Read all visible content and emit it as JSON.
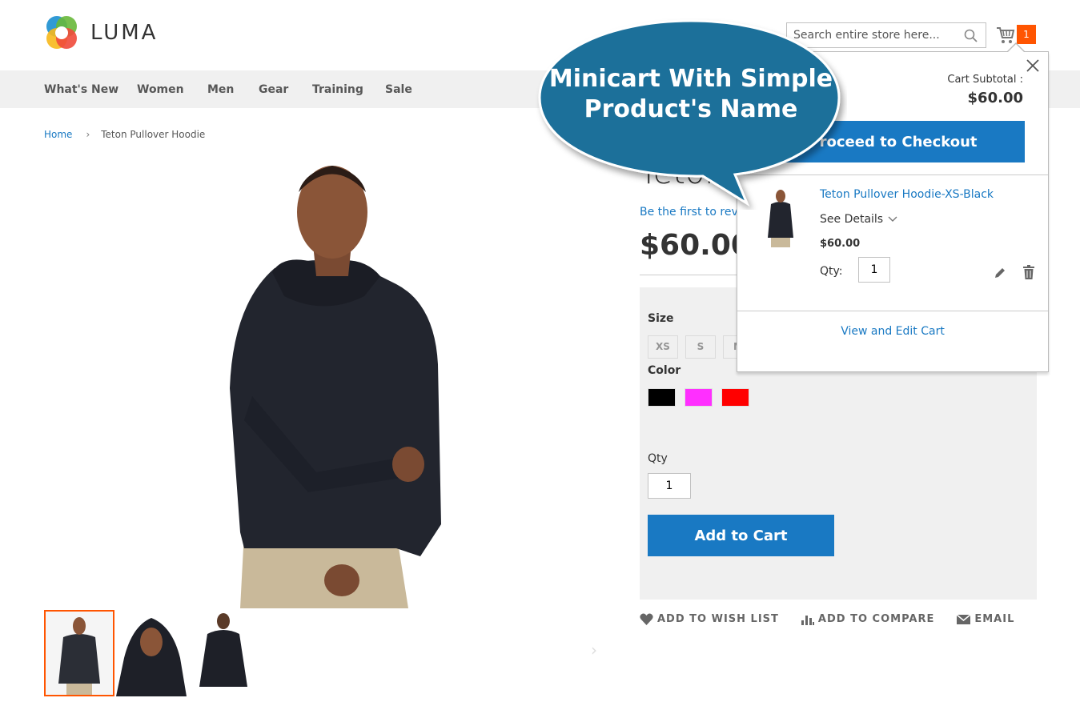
{
  "header": {
    "logo_text": "LUMA",
    "search_placeholder": "Search entire store here...",
    "cart_count": "1"
  },
  "nav": {
    "items": [
      "What's New",
      "Women",
      "Men",
      "Gear",
      "Training",
      "Sale"
    ]
  },
  "breadcrumb": {
    "home": "Home",
    "current": "Teton Pullover Hoodie"
  },
  "product": {
    "title": "Teton P",
    "review_link": "Be the first to revie",
    "price": "$60.00",
    "size_label": "Size",
    "sizes": [
      "XS",
      "S",
      "M"
    ],
    "color_label": "Color",
    "colors": [
      "#000000",
      "#ff2fff",
      "#ff0000"
    ],
    "qty_label": "Qty",
    "qty_value": "1",
    "add_to_cart": "Add to Cart",
    "actions": {
      "wishlist": "ADD TO WISH LIST",
      "compare": "ADD TO COMPARE",
      "email": "EMAIL"
    }
  },
  "minicart": {
    "subtotal_label": "Cart Subtotal :",
    "subtotal_value": "$60.00",
    "checkout_label": "Proceed to Checkout",
    "item": {
      "name": "Teton Pullover Hoodie-XS-Black",
      "details": "See Details",
      "price": "$60.00",
      "qty_label": "Qty:",
      "qty_value": "1"
    },
    "view_edit": "View and Edit Cart"
  },
  "callout": {
    "line1": "Minicart With Simple",
    "line2": "Product's Name"
  },
  "colors": {
    "accent_blue": "#1979c3",
    "counter_orange": "#ff5501",
    "callout_blue": "#1a6f9a"
  }
}
